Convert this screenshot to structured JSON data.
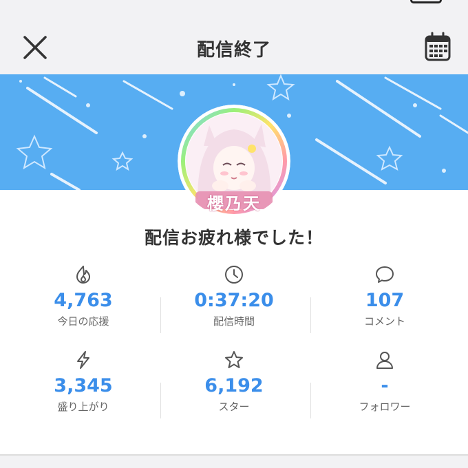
{
  "header": {
    "title": "配信終了",
    "close_icon": "close-icon",
    "calendar_icon": "calendar-icon"
  },
  "profile": {
    "avatar_text": "櫻乃天"
  },
  "message": "配信お疲れ様でした！",
  "stats": [
    {
      "icon": "fire-icon",
      "value": "4,763",
      "label": "今日の応援"
    },
    {
      "icon": "clock-icon",
      "value": "0:37:20",
      "label": "配信時間"
    },
    {
      "icon": "comment-icon",
      "value": "107",
      "label": "コメント"
    },
    {
      "icon": "lightning-icon",
      "value": "3,345",
      "label": "盛り上がり"
    },
    {
      "icon": "star-icon",
      "value": "6,192",
      "label": "スター"
    },
    {
      "icon": "person-icon",
      "value": "-",
      "label": "フォロワー"
    }
  ],
  "colors": {
    "accent": "#3b8eea",
    "banner": "#57adf2"
  }
}
